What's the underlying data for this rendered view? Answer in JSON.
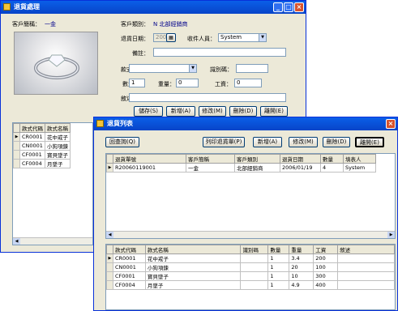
{
  "win1": {
    "title": "退貨處理",
    "customer_name_label": "客戶簡稱：",
    "customer_name_value": "一金",
    "customer_type_label": "客戶類別：",
    "customer_type_value": "N 北部經銷商",
    "return_date_label": "退貨日期：",
    "return_date_value": "2006/1/19",
    "receiver_label": "收件人員：",
    "receiver_value": "System",
    "remark_label": "備註：",
    "style_no_label": "款式編號：",
    "id_code_label": "識別碼：",
    "qty_label": "數量：",
    "qty_value": "1",
    "weight_label": "重量：",
    "weight_value": "0",
    "labor_label": "工資：",
    "labor_value": "0",
    "desc_label": "敘述：",
    "buttons": {
      "save": "儲存(S)",
      "add": "新增(A)",
      "edit": "修改(M)",
      "delete": "刪除(D)",
      "leave": "離開(E)"
    },
    "grid_headers": [
      "款式代碼",
      "款式名稱"
    ],
    "grid_rows": [
      [
        "CR0001",
        "花中戒子"
      ],
      [
        "CN0001",
        "小狗項鍊"
      ],
      [
        "CF0001",
        "寶貝墜子"
      ],
      [
        "CF0004",
        "月墜子"
      ]
    ]
  },
  "win2": {
    "title": "退貨列表",
    "buttons": {
      "back": "回查詢(Q)",
      "print": "列印退貨單(P)",
      "add": "新增(A)",
      "edit": "修改(M)",
      "delete": "刪除(D)",
      "leave": "離開(E)"
    },
    "top_headers": [
      "退貨單號",
      "客戶簡稱",
      "客戶類別",
      "退貨日期",
      "數量",
      "填表人"
    ],
    "top_rows": [
      [
        "R20060119001",
        "一金",
        "北部經銷商",
        "2006/01/19",
        "4",
        "System"
      ]
    ],
    "bottom_headers": [
      "款式代碼",
      "款式名稱",
      "識別碼",
      "數量",
      "重量",
      "工資",
      "敘述"
    ],
    "bottom_rows": [
      [
        "CR0001",
        "花中戒子",
        "",
        "1",
        "3.4",
        "200",
        ""
      ],
      [
        "CN0001",
        "小狗項鍊",
        "",
        "1",
        "20",
        "100",
        ""
      ],
      [
        "CF0001",
        "寶貝墜子",
        "",
        "1",
        "10",
        "300",
        ""
      ],
      [
        "CF0004",
        "月墜子",
        "",
        "1",
        "4.9",
        "400",
        ""
      ]
    ]
  },
  "icons": {
    "close": "×",
    "minimize": "_",
    "maximize": "□",
    "dropdown": "▼",
    "row_pointer": "▶"
  }
}
